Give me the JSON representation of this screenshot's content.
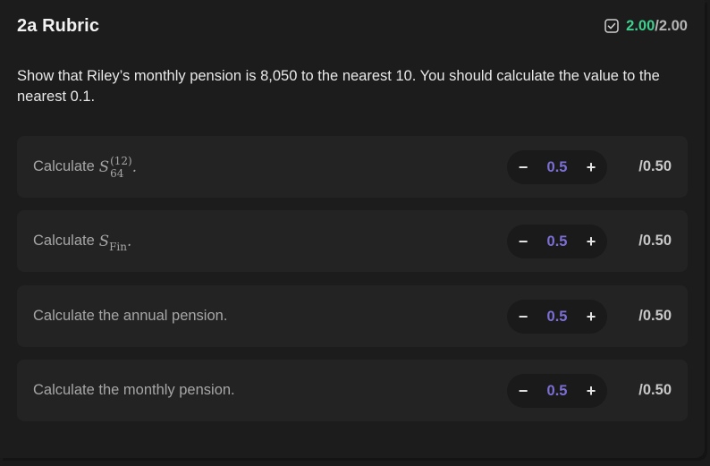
{
  "header": {
    "title": "2a Rubric",
    "score_earned": "2.00",
    "score_separator": "/",
    "score_total": "2.00",
    "score_color": "#3fcf8e"
  },
  "prompt": "Show that Riley’s monthly pension is 8,050 to the nearest 10. You should calculate the value to the nearest 0.1.",
  "criteria": [
    {
      "label": "Calculate",
      "math": {
        "symbol": "S",
        "sup": "(12)",
        "sub": "64",
        "trail": "."
      },
      "value": "0.5",
      "max": "/0.50",
      "minus": "−",
      "plus": "+"
    },
    {
      "label": "Calculate",
      "math": {
        "symbol": "S",
        "sub": "Fin",
        "trail": "."
      },
      "value": "0.5",
      "max": "/0.50",
      "minus": "−",
      "plus": "+"
    },
    {
      "label": "Calculate the annual pension.",
      "value": "0.5",
      "max": "/0.50",
      "minus": "−",
      "plus": "+"
    },
    {
      "label": "Calculate the monthly pension.",
      "value": "0.5",
      "max": "/0.50",
      "minus": "−",
      "plus": "+"
    }
  ],
  "colors": {
    "background": "#1c1c1c",
    "card": "#232323",
    "value_accent": "#7b6fd6"
  },
  "icons": {
    "score_badge": "checkbox-check-icon"
  }
}
